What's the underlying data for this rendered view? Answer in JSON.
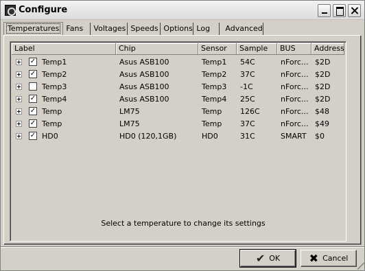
{
  "window": {
    "title": "Configure"
  },
  "tabs": [
    {
      "label": "Temperatures",
      "active": true
    },
    {
      "label": "Fans"
    },
    {
      "label": "Voltages"
    },
    {
      "label": "Speeds"
    },
    {
      "label": "Options"
    },
    {
      "label": "Log"
    },
    {
      "label": "Advanced"
    }
  ],
  "table": {
    "columns": [
      "Label",
      "Chip",
      "Sensor",
      "Sample",
      "BUS",
      "Address"
    ],
    "rows": [
      {
        "checked": true,
        "label": "Temp1",
        "chip": "Asus ASB100",
        "sensor": "Temp1",
        "sample": "54C",
        "bus": "nForc...",
        "address": "$2D"
      },
      {
        "checked": true,
        "label": "Temp2",
        "chip": "Asus ASB100",
        "sensor": "Temp2",
        "sample": "37C",
        "bus": "nForc...",
        "address": "$2D"
      },
      {
        "checked": false,
        "label": "Temp3",
        "chip": "Asus ASB100",
        "sensor": "Temp3",
        "sample": "-1C",
        "bus": "nForc...",
        "address": "$2D"
      },
      {
        "checked": true,
        "label": "Temp4",
        "chip": "Asus ASB100",
        "sensor": "Temp4",
        "sample": "25C",
        "bus": "nForc...",
        "address": "$2D"
      },
      {
        "checked": true,
        "label": "Temp",
        "chip": "LM75",
        "sensor": "Temp",
        "sample": "126C",
        "bus": "nForc...",
        "address": "$48"
      },
      {
        "checked": true,
        "label": "Temp",
        "chip": "LM75",
        "sensor": "Temp",
        "sample": "37C",
        "bus": "nForc...",
        "address": "$49"
      },
      {
        "checked": true,
        "label": "HD0",
        "chip": "HD0 (120,1GB)",
        "sensor": "HD0",
        "sample": "31C",
        "bus": "SMART",
        "address": "$0"
      }
    ]
  },
  "hint": "Select a temperature to change its settings",
  "buttons": {
    "ok": "OK",
    "cancel": "Cancel"
  }
}
